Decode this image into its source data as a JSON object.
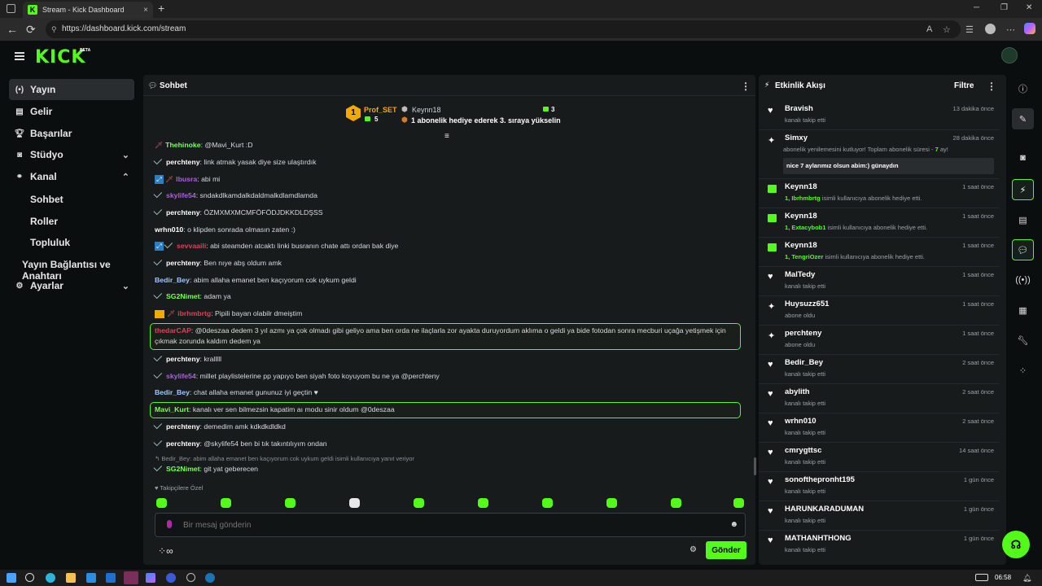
{
  "browser": {
    "tab_title": "Stream - Kick Dashboard",
    "url": "https://dashboard.kick.com/stream",
    "new_tab": "+",
    "tab_close": "×",
    "back": "←",
    "reload": "⟳"
  },
  "brand": {
    "logo": "KICK",
    "beta": "BETA",
    "accent": "#53fc18"
  },
  "sidebar": {
    "items": [
      {
        "label": "Yayın",
        "icon": "broadcast-icon"
      },
      {
        "label": "Gelir",
        "icon": "revenue-icon"
      },
      {
        "label": "Başarılar",
        "icon": "trophy-icon"
      },
      {
        "label": "Stüdyo",
        "icon": "studio-icon"
      },
      {
        "label": "Kanal",
        "icon": "channel-icon"
      },
      {
        "label": "Ayarlar",
        "icon": "gear-icon"
      }
    ],
    "sub_items": [
      "Sohbet",
      "Roller",
      "Topluluk",
      "Yayın Bağlantısı ve Anahtarı"
    ]
  },
  "chat": {
    "title": "Sohbet",
    "pinned": {
      "gifter_name": "Prof_SET",
      "gifter_rank": "1",
      "gifter_count": "5",
      "second_name": "Keynn18",
      "second_count": "3",
      "rank_text": "1 abonelik hediye ederek 3. sıraya yükselin"
    },
    "messages": [
      {
        "user": "Thehinoke",
        "color": "#7cff5a",
        "text": "@Mavi_Kurt :D"
      },
      {
        "user": "perchteny",
        "color": "#ffffff",
        "text": "link atmak yasak diye size ulaştırdık"
      },
      {
        "user": "lbusra",
        "color": "#b05ee0",
        "text": "abi mi"
      },
      {
        "user": "skylife54",
        "color": "#b05ee0",
        "text": "sndakdlkamdalkdaldmalkdlamdlamda"
      },
      {
        "user": "perchteny",
        "color": "#ffffff",
        "text": "ÖZMXMXMCMFÖFÖDJDKKDLDŞSS"
      },
      {
        "user": "wrhn010",
        "color": "#ffffff",
        "text": "o klipden sonrada olmasın zaten :)"
      },
      {
        "user": "sevvaaili",
        "color": "#e0405a",
        "text": "abi steamden atcaktı linki busranın chate attı ordan bak diye"
      },
      {
        "user": "perchteny",
        "color": "#ffffff",
        "text": "Ben nıye abş oldum amk"
      },
      {
        "user": "Bedir_Bey",
        "color": "#9ec8ff",
        "text": "abim allaha emanet ben kaçıyorum cok uykum geldi"
      },
      {
        "user": "SG2Nimet",
        "color": "#7cff5a",
        "text": "adam ya"
      },
      {
        "user": "ibrhmbrtg",
        "color": "#e0405a",
        "text": "Pipili bayan olabilr dmeiştim"
      },
      {
        "user": "thedarCAP",
        "color": "#e0405a",
        "text": "@0deszaa dedem 3 yıl azmı ya çok olmadı gibi geliyo ama ben orda ne ilaçlarla zor ayakta duruyordum aklıma o geldi ya bide fotodan sonra mecburi uçağa yetişmek için çıkmak zorunda kaldım dedem ya"
      },
      {
        "user": "perchteny",
        "color": "#ffffff",
        "text": "kralllll"
      },
      {
        "user": "skylife54",
        "color": "#b05ee0",
        "text": "millet playlistelerine pp yapıyo ben siyah foto koyuyom bu ne ya @perchteny"
      },
      {
        "user": "Bedir_Bey",
        "color": "#9ec8ff",
        "text": "chat allaha emanet gununuz iyi geçtin ♥"
      },
      {
        "user": "Mavi_Kurt",
        "color": "#7cff5a",
        "text": "kanalı ver sen bilmezsin kapatim aı modu sinir oldum @0deszaa"
      },
      {
        "user": "perchteny",
        "color": "#ffffff",
        "text": "demedim amk kdkdkdldkd"
      },
      {
        "user": "perchteny",
        "color": "#ffffff",
        "text": "@skylife54 ben bi tık takıntılıyım ondan"
      },
      {
        "user": "SG2Nimet",
        "color": "#7cff5a",
        "text": "git yat geberecen"
      }
    ],
    "reply_note": "Bedir_Bey: abim allaha emanet ben kaçıyorum cok uykum geldi isimli kullanıcıya yanıt veriyor",
    "emote_label": "♥ Takipçilere Özel",
    "input_placeholder": "Bir mesaj gönderin",
    "send_label": "Gönder",
    "loop_label": "∞"
  },
  "activity": {
    "title": "Etkinlik Akışı",
    "filter_label": "Filtre",
    "events": [
      {
        "icon": "heart-icon",
        "name": "Bravish",
        "time": "13 dakika önce",
        "desc": "kanalı takip etti"
      },
      {
        "icon": "resub-icon",
        "name": "Simxy",
        "time": "28 dakika önce",
        "desc_pre": "abonelik yenilemesini kutluyor! Toplam abonelik süresi - ",
        "desc_hl": "7",
        "desc_post": " ay!",
        "note": "nice 7 aylarımız olsun abim:) günaydın"
      },
      {
        "icon": "gift-icon",
        "name": "Keynn18",
        "time": "1 saat önce",
        "desc_hl": "1, Ibrhmbrtg",
        "desc_post": " isimli kullanıcıya abonelik hediye etti."
      },
      {
        "icon": "gift-icon",
        "name": "Keynn18",
        "time": "1 saat önce",
        "desc_hl": "1, Extacybob1",
        "desc_post": " isimli kullanıcıya abonelik hediye etti."
      },
      {
        "icon": "gift-icon",
        "name": "Keynn18",
        "time": "1 saat önce",
        "desc_hl": "1, TengriOzer",
        "desc_post": " isimli kullanıcıya abonelik hediye etti."
      },
      {
        "icon": "heart-icon",
        "name": "MalTedy",
        "time": "1 saat önce",
        "desc": "kanalı takip etti"
      },
      {
        "icon": "sparkle-icon",
        "name": "Huysuzz651",
        "time": "1 saat önce",
        "desc": "abone oldu"
      },
      {
        "icon": "sparkle-icon",
        "name": "perchteny",
        "time": "1 saat önce",
        "desc": "abone oldu"
      },
      {
        "icon": "heart-icon",
        "name": "Bedir_Bey",
        "time": "2 saat önce",
        "desc": "kanalı takip etti"
      },
      {
        "icon": "heart-icon",
        "name": "abylith",
        "time": "2 saat önce",
        "desc": "kanalı takip etti"
      },
      {
        "icon": "heart-icon",
        "name": "wrhn010",
        "time": "2 saat önce",
        "desc": "kanalı takip etti"
      },
      {
        "icon": "heart-icon",
        "name": "cmrygttsc",
        "time": "14 saat önce",
        "desc": "kanalı takip etti"
      },
      {
        "icon": "heart-icon",
        "name": "sonoftheproпht195",
        "time": "1 gün önce",
        "desc": "kanalı takip etti"
      },
      {
        "icon": "heart-icon",
        "name": "HARUNKARADUMAN",
        "time": "1 gün önce",
        "desc": "kanalı takip etti"
      },
      {
        "icon": "heart-icon",
        "name": "MATHANHTHONG",
        "time": "1 gün önce",
        "desc": "kanalı takip etti"
      }
    ]
  },
  "taskbar": {
    "clock": "06:58"
  }
}
